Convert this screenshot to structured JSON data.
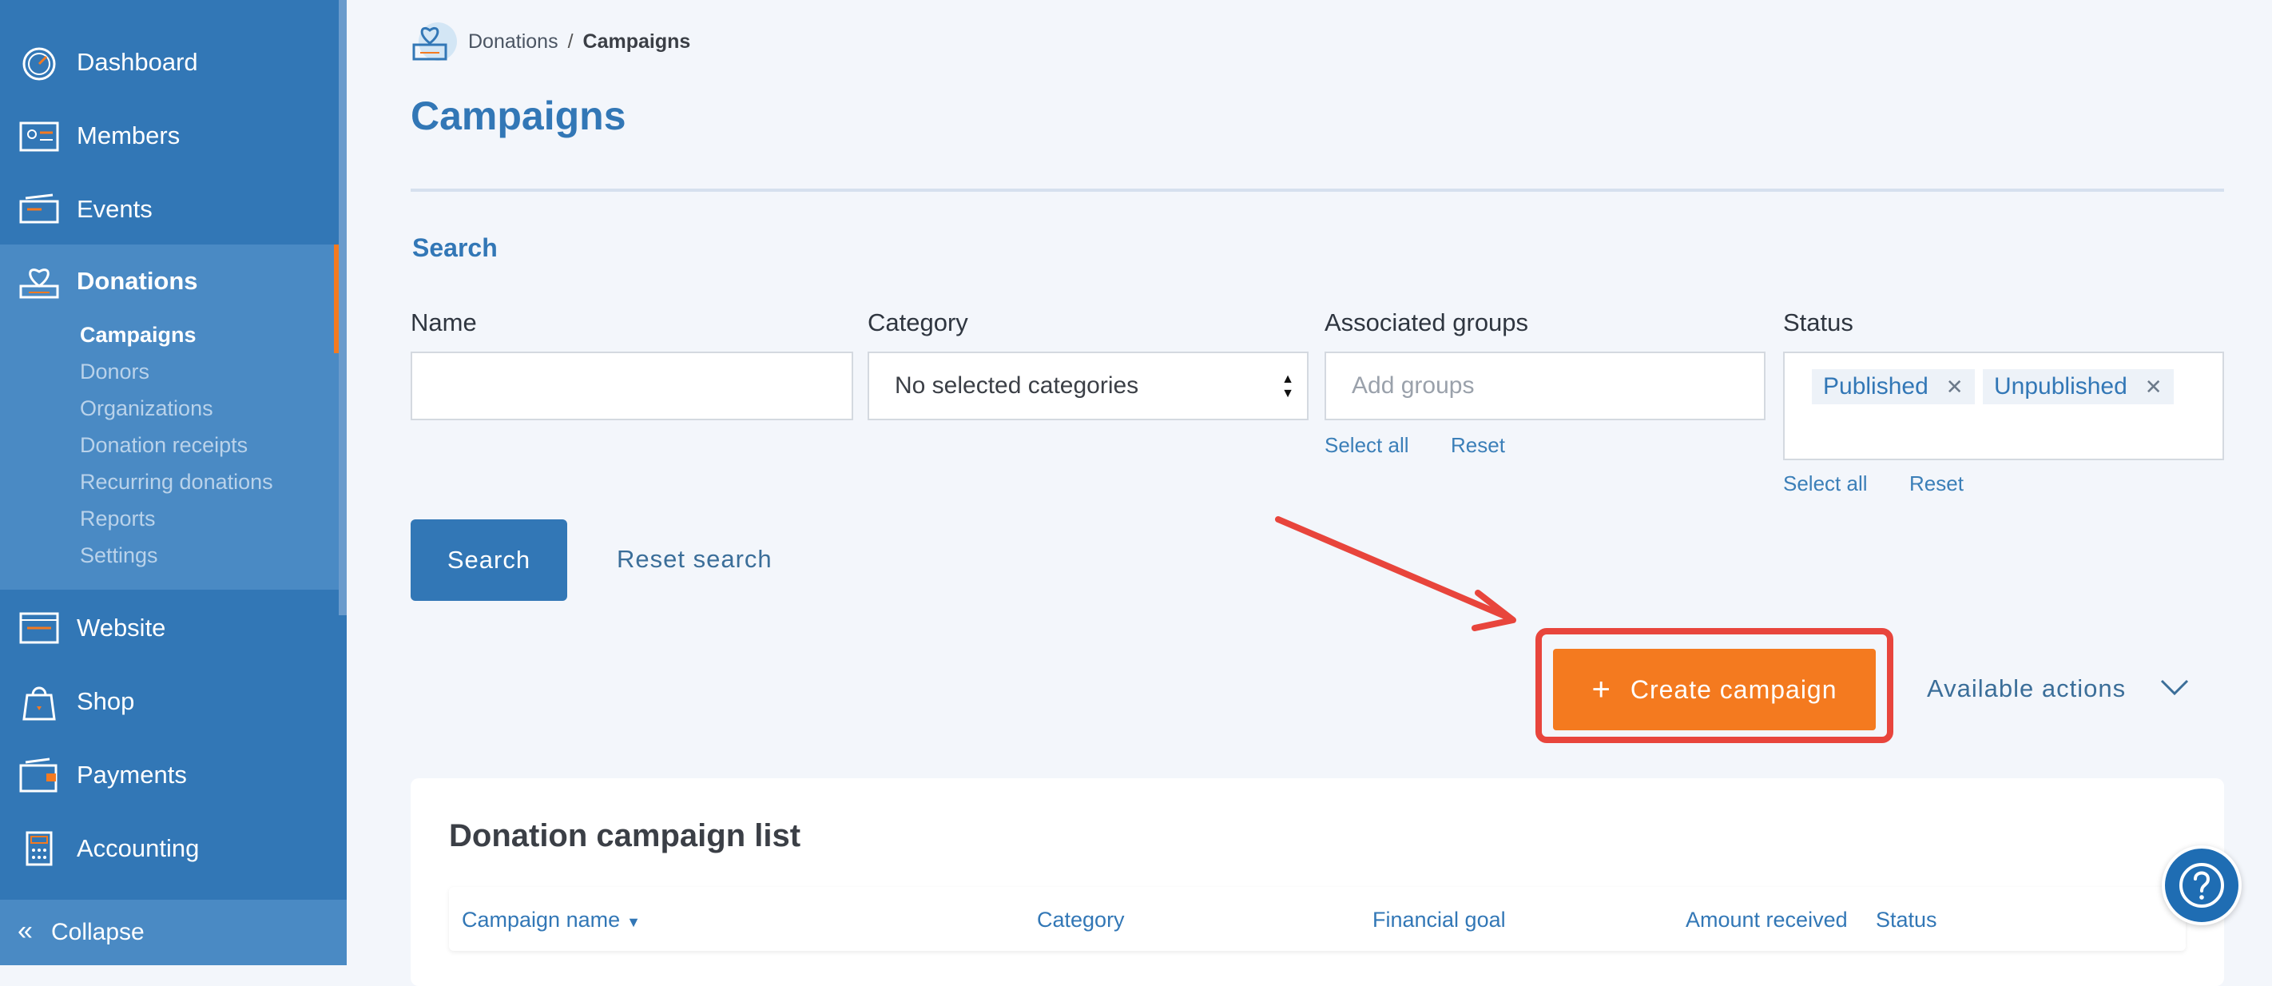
{
  "sidebar": {
    "items": [
      {
        "label": "Dashboard",
        "icon": "dashboard-gauge-icon"
      },
      {
        "label": "Members",
        "icon": "members-card-icon"
      },
      {
        "label": "Events",
        "icon": "events-ticket-icon"
      },
      {
        "label": "Donations",
        "icon": "donations-heart-icon",
        "active": true
      },
      {
        "label": "Website",
        "icon": "website-browser-icon"
      },
      {
        "label": "Shop",
        "icon": "shop-bag-icon"
      },
      {
        "label": "Payments",
        "icon": "payments-wallet-icon"
      },
      {
        "label": "Accounting",
        "icon": "accounting-calculator-icon"
      }
    ],
    "sub_items": [
      "Campaigns",
      "Donors",
      "Organizations",
      "Donation receipts",
      "Recurring donations",
      "Reports",
      "Settings"
    ],
    "collapse_label": "Collapse",
    "colors": {
      "background": "#3277b6",
      "active": "#4a8ac4",
      "marker": "#f47a20"
    }
  },
  "breadcrumb": {
    "parent": "Donations",
    "separator": "/",
    "current": "Campaigns"
  },
  "page_title": "Campaigns",
  "search": {
    "title": "Search",
    "name_label": "Name",
    "name_value": "",
    "category_label": "Category",
    "category_value": "No selected categories",
    "groups_label": "Associated groups",
    "groups_placeholder": "Add groups",
    "groups_select_all": "Select all",
    "groups_reset": "Reset",
    "status_label": "Status",
    "status_tags": [
      "Published",
      "Unpublished"
    ],
    "status_select_all": "Select all",
    "status_reset": "Reset",
    "search_button": "Search",
    "reset_search": "Reset search"
  },
  "actions": {
    "create_campaign": "Create campaign",
    "available_actions": "Available actions",
    "accent": "#f47a1f",
    "highlight": "#e8453c"
  },
  "list": {
    "title": "Donation campaign list",
    "columns": [
      "Campaign name",
      "Category",
      "Financial goal",
      "Amount received",
      "Status"
    ]
  },
  "help_icon": "question-mark-icon"
}
